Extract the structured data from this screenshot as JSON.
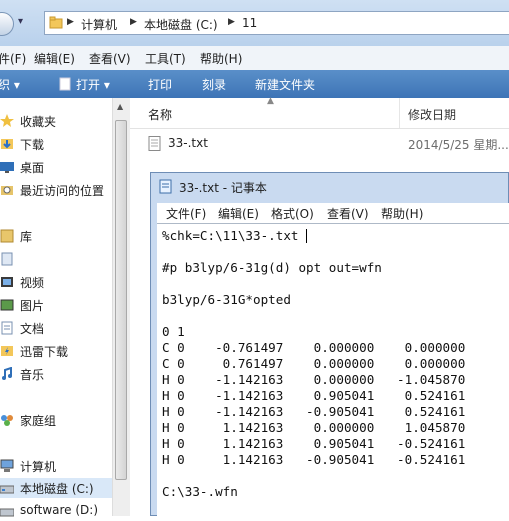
{
  "address": {
    "crumbs": [
      "计算机",
      "本地磁盘 (C:)",
      "11"
    ]
  },
  "menubar": {
    "items": [
      "件(F)",
      "编辑(E)",
      "查看(V)",
      "工具(T)",
      "帮助(H)"
    ]
  },
  "commandbar": {
    "items": [
      "织 ▾",
      "打开 ▾",
      "打印",
      "刻录",
      "新建文件夹"
    ]
  },
  "sidebar": {
    "items": [
      {
        "label": "收藏夹",
        "icon": "star-icon"
      },
      {
        "label": "下载",
        "icon": "download-folder-icon"
      },
      {
        "label": "桌面",
        "icon": "desktop-icon"
      },
      {
        "label": "最近访问的位置",
        "icon": "recent-places-icon"
      },
      {
        "label": "库",
        "icon": "library-icon"
      },
      {
        "label": "",
        "icon": "library-item-icon"
      },
      {
        "label": "视频",
        "icon": "video-icon"
      },
      {
        "label": "图片",
        "icon": "pictures-icon"
      },
      {
        "label": "文档",
        "icon": "documents-icon"
      },
      {
        "label": "迅雷下载",
        "icon": "thunder-download-icon"
      },
      {
        "label": "音乐",
        "icon": "music-icon"
      },
      {
        "label": "家庭组",
        "icon": "homegroup-icon"
      },
      {
        "label": "计算机",
        "icon": "computer-icon"
      },
      {
        "label": "本地磁盘 (C:)",
        "icon": "drive-c-icon"
      },
      {
        "label": "software (D:)",
        "icon": "drive-d-icon"
      }
    ]
  },
  "filelist": {
    "columns": {
      "name": "名称",
      "modified": "修改日期"
    },
    "files": [
      {
        "name": "33-.txt",
        "modified": "2014/5/25 星期..."
      }
    ]
  },
  "notepad": {
    "title": "33-.txt - 记事本",
    "menu": [
      "文件(F)",
      "编辑(E)",
      "格式(O)",
      "查看(V)",
      "帮助(H)"
    ],
    "content": "%chk=C:\\11\\33-.txt\n\n#p b3lyp/6-31g(d) opt out=wfn\n\nb3lyp/6-31G*opted\n\n0 1\nC 0    -0.761497    0.000000    0.000000\nC 0     0.761497    0.000000    0.000000\nH 0    -1.142163    0.000000   -1.045870\nH 0    -1.142163    0.905041    0.524161\nH 0    -1.142163   -0.905041    0.524161\nH 0     1.142163    0.000000    1.045870\nH 0     1.142163    0.905041   -0.524161\nH 0     1.142163   -0.905041   -0.524161\n\nC:\\33-.wfn"
  }
}
